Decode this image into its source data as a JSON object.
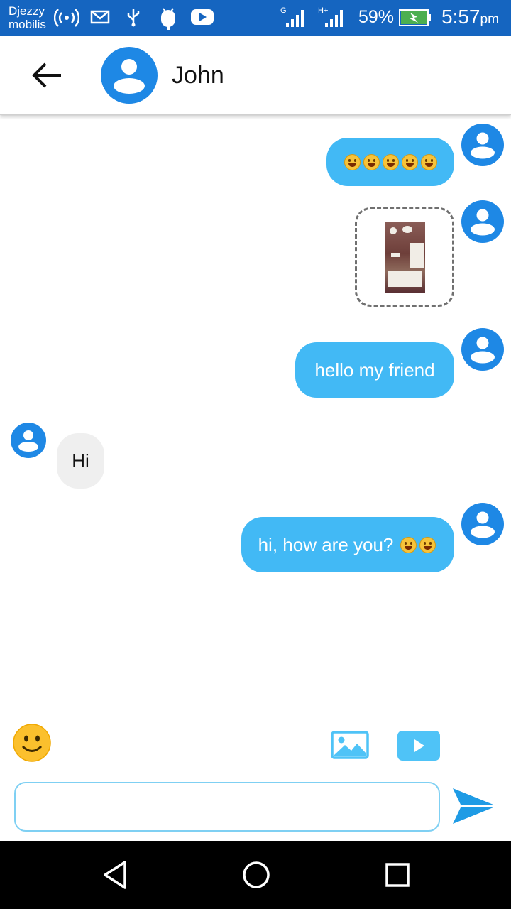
{
  "status_bar": {
    "carrier_line1": "Djezzy",
    "carrier_line2": "mobilis",
    "network1": "G",
    "network2": "H+",
    "battery": "59%",
    "time": "5:57",
    "time_suffix": "pm",
    "icons": [
      "hotspot-icon",
      "mail-icon",
      "usb-icon",
      "android-icon",
      "youtube-icon",
      "signal-icon",
      "signal-icon",
      "battery-charging-icon"
    ],
    "background": "#1565c0"
  },
  "header": {
    "contact_name": "John",
    "back_icon": "arrow-left-icon",
    "avatar_icon": "person-avatar-icon"
  },
  "messages": [
    {
      "side": "out",
      "type": "emoji",
      "emojis": [
        "yum",
        "wink-tongue",
        "blush",
        "wink-tongue",
        "grin"
      ]
    },
    {
      "side": "out",
      "type": "image",
      "icon": "image-thumbnail"
    },
    {
      "side": "out",
      "type": "text",
      "text": "hello my friend"
    },
    {
      "side": "in",
      "type": "text",
      "text": "Hi"
    },
    {
      "side": "out",
      "type": "text",
      "text": "hi, how are you?",
      "emojis": [
        "grin",
        "sweat-smile"
      ]
    }
  ],
  "composer": {
    "input_value": "",
    "input_placeholder": "",
    "emoji_icon": "smiley-icon",
    "image_icon": "image-icon",
    "video_icon": "video-icon",
    "send_icon": "send-icon"
  },
  "nav": {
    "back": "back-triangle-icon",
    "home": "home-circle-icon",
    "recents": "recents-square-icon"
  },
  "colors": {
    "accent": "#1e88e5",
    "outgoing_bubble": "#42b9f5",
    "incoming_bubble": "#efefef"
  }
}
